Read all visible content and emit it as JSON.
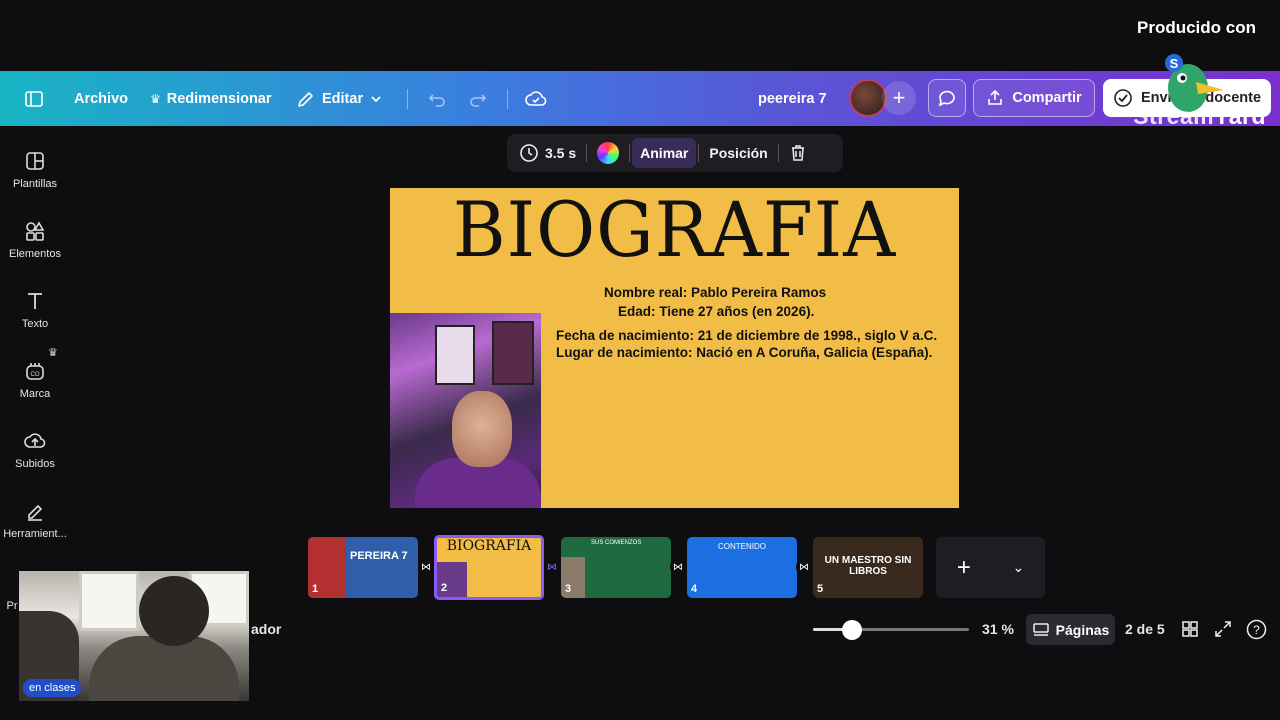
{
  "overlay": {
    "producido": "Producido con",
    "streamyard_stream": "Stream",
    "streamyard_yard": "Yard",
    "live_badge": "en clases"
  },
  "topbar": {
    "archivo": "Archivo",
    "redimensionar": "Redimensionar",
    "editar": "Editar",
    "project_name": "peereira 7",
    "compartir": "Compartir",
    "enviar": "Enviar al docente"
  },
  "sidebar": {
    "items": [
      {
        "label": "Plantillas"
      },
      {
        "label": "Elementos"
      },
      {
        "label": "Texto"
      },
      {
        "label": "Marca"
      },
      {
        "label": "Subidos"
      },
      {
        "label": "Herramient..."
      }
    ],
    "partial": "Pr"
  },
  "element_toolbar": {
    "duration": "3.5 s",
    "animar": "Animar",
    "posicion": "Posición"
  },
  "slide": {
    "title": "BIOGRAFIA",
    "lines": [
      "Nombre real: Pablo Pereira Ramos",
      "Edad: Tiene 27 años (en 2026).",
      "Fecha de nacimiento: 21 de diciembre de 1998., siglo V a.C.",
      "Lugar de nacimiento: Nació en A Coruña, Galicia (España)."
    ]
  },
  "thumbnails": [
    {
      "num": "1",
      "title": "PEREIRA 7",
      "bg": "#2e5fa8"
    },
    {
      "num": "2",
      "title": "BIOGRAFIA",
      "bg": "#f2bd47"
    },
    {
      "num": "3",
      "title": "SUS COMIENZOS",
      "bg": "#1f6b3f"
    },
    {
      "num": "4",
      "title": "CONTENIDO",
      "bg": "#1c6fe0"
    },
    {
      "num": "5",
      "title": "UN MAESTRO SIN LIBROS",
      "bg": "#3a2a1e"
    }
  ],
  "footer": {
    "partial_left": "ador",
    "zoom_pct": 31,
    "zoom": "31 %",
    "paginas": "Páginas",
    "page_indicator": "2 de 5"
  }
}
